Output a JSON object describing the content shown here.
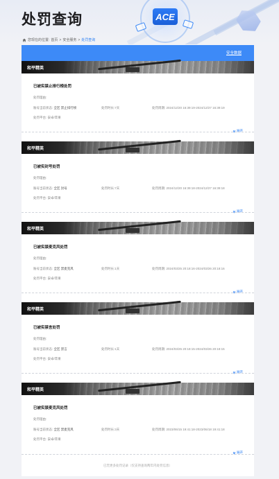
{
  "page": {
    "title": "处罚查询"
  },
  "logo": {
    "text": "ACE"
  },
  "breadcrumb": {
    "prefix": "您现在的位置:",
    "items": [
      "首页",
      "安全服务",
      "处罚查询"
    ],
    "separator": ">"
  },
  "toolbar": {
    "link_label": "安全数据"
  },
  "labels": {
    "punish_type": "处罚理由:",
    "account_state": "账号当前状态:",
    "duration": "处罚时长:",
    "period": "处罚周期:",
    "platform": "处罚平台:",
    "expand": "展开"
  },
  "records": [
    {
      "game": "和平精英",
      "title": "已被实禁止排行榜处罚",
      "state": "全区 禁止排行榜",
      "duration": "7天",
      "period": "2024/12/20 16:39:19-2024/12/27 16:39:19",
      "platform": "安卓/苹果"
    },
    {
      "game": "和平精英",
      "title": "已被实封号处罚",
      "state": "全区 封号",
      "duration": "7天",
      "period": "2024/12/20 16:39:18-2024/12/27 16:39:18",
      "platform": "安卓/苹果"
    },
    {
      "game": "和平精英",
      "title": "已被实禁麦克风处罚",
      "state": "全区 禁麦克风",
      "duration": "1天",
      "period": "2024/03/25 20:18:16-2024/03/26 20:18:16",
      "platform": "安卓/苹果"
    },
    {
      "game": "和平精英",
      "title": "已被实禁言处罚",
      "state": "全区 禁言",
      "duration": "1天",
      "period": "2024/03/25 20:18:15-2024/03/26 20:18:15",
      "platform": "安卓/苹果"
    },
    {
      "game": "和平精英",
      "title": "已被实禁麦克风处罚",
      "state": "全区 禁麦克风",
      "duration": "3天",
      "period": "2023/06/15 19:41:18-2023/06/18 19:41:18",
      "platform": "安卓/苹果"
    }
  ],
  "footer": {
    "note": "已无更多处罚记录（仅支持查询两年内处罚信息）"
  },
  "colors": {
    "accent": "#3d8af7",
    "link": "#2b7ff4"
  }
}
